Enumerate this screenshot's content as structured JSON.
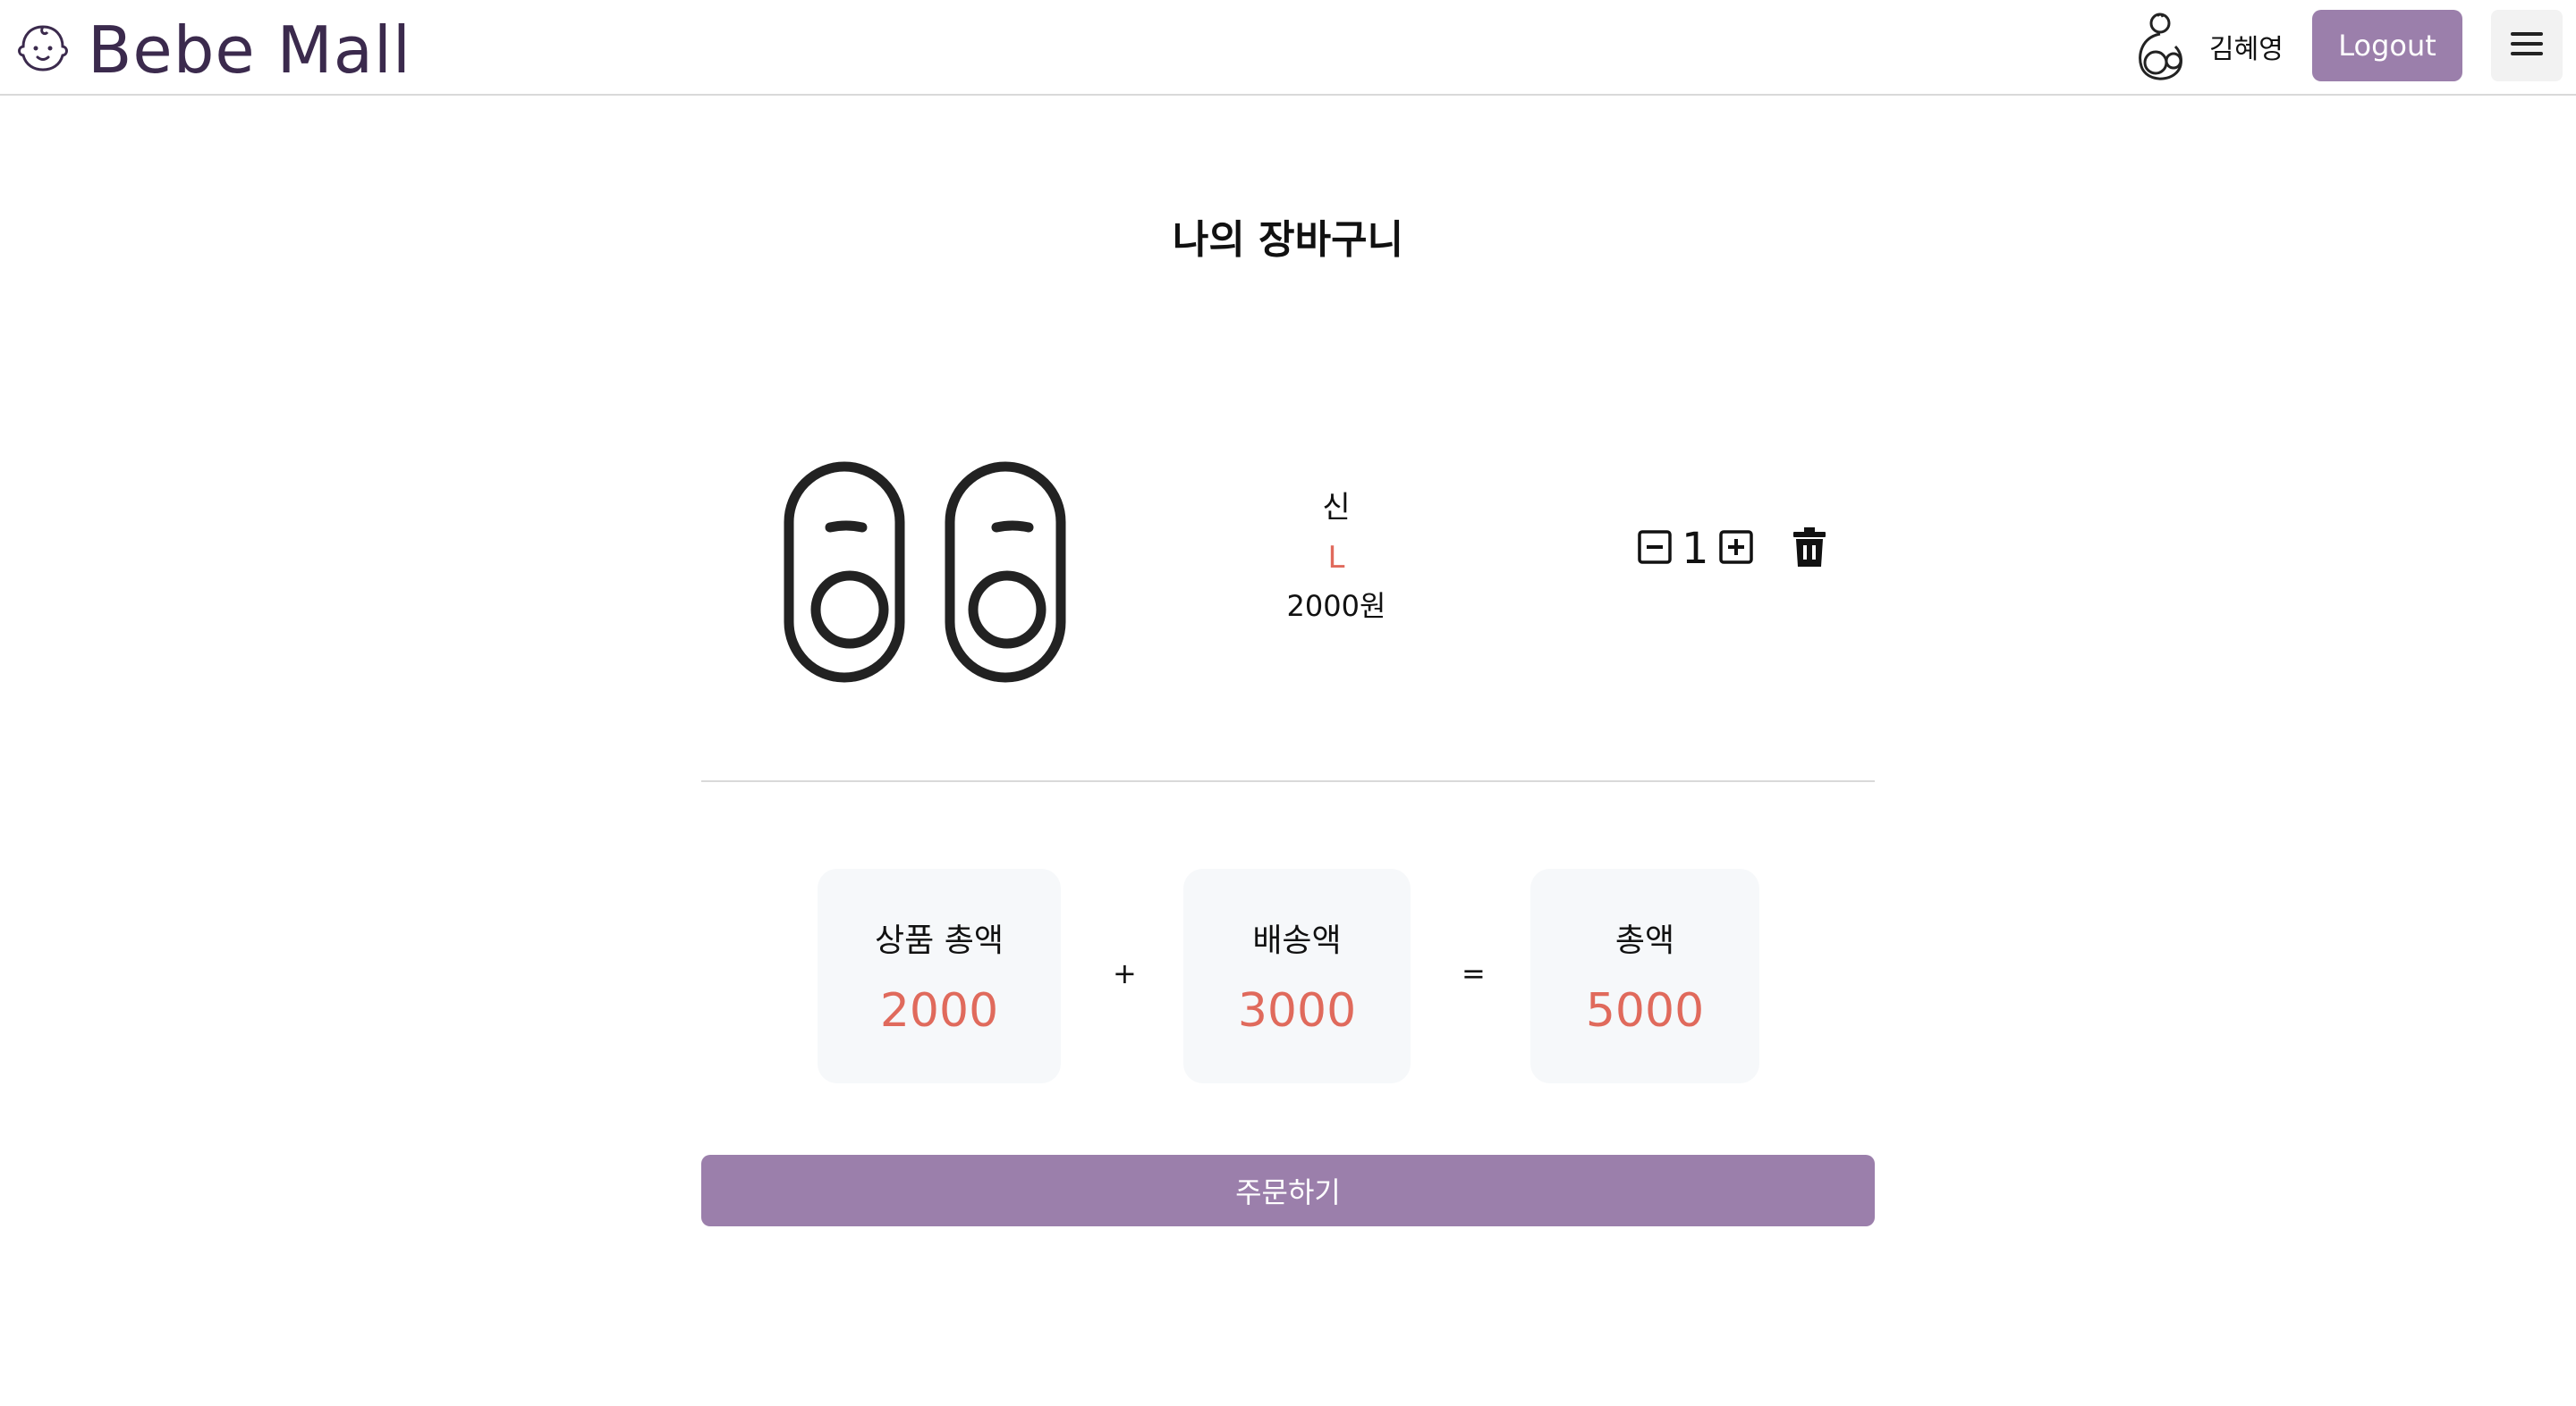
{
  "header": {
    "logo_text": "Bebe Mall",
    "user_name": "김혜영",
    "logout_label": "Logout",
    "menu_icon": "hamburger-icon",
    "logo_icon": "baby-face-icon",
    "user_icon": "baby-avatar-icon"
  },
  "page": {
    "title": "나의 장바구니"
  },
  "cart": {
    "items": [
      {
        "name": "신",
        "size": "L",
        "price": "2000원",
        "quantity": "1",
        "image_icon": "baby-shoes-icon"
      }
    ]
  },
  "summary": {
    "product_total_label": "상품 총액",
    "product_total_value": "2000",
    "plus": "+",
    "shipping_label": "배송액",
    "shipping_value": "3000",
    "equals": "=",
    "total_label": "총액",
    "total_value": "5000"
  },
  "order_button_label": "주문하기",
  "colors": {
    "accent": "#9b7fab",
    "price_highlight": "#e06a5c",
    "card_bg": "#f6f8fa"
  }
}
